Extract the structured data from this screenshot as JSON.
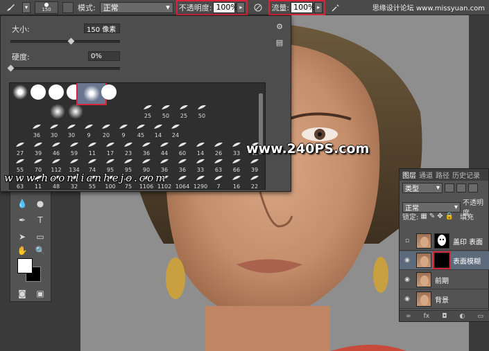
{
  "options_bar": {
    "brush_size": "150",
    "mode_label": "模式:",
    "mode_value": "正常",
    "opacity_label": "不透明度:",
    "opacity_value": "100%",
    "flow_label": "流量:",
    "flow_value": "100%",
    "watermark": "思缘设计论坛 www.missyuan.com"
  },
  "brush_picker": {
    "size_label": "大小:",
    "size_value": "150 像素",
    "size_level": 0.55,
    "hardness_label": "硬度:",
    "hardness_value": "0%",
    "hardness_level": 0.0,
    "row2": [
      "25",
      "50",
      "25",
      "50"
    ],
    "row3": [
      "36",
      "30",
      "30",
      "9",
      "20",
      "9",
      "45",
      "14",
      "24"
    ],
    "row4": [
      "27",
      "39",
      "46",
      "59",
      "11",
      "17",
      "23",
      "36",
      "44",
      "60",
      "14",
      "26",
      "33",
      "42"
    ],
    "row5": [
      "55",
      "70",
      "112",
      "134",
      "74",
      "95",
      "95",
      "90",
      "36",
      "36",
      "33",
      "63",
      "66",
      "39"
    ],
    "row6": [
      "63",
      "11",
      "48",
      "32",
      "55",
      "100",
      "75",
      "1106",
      "1102",
      "1064",
      "1290",
      "7",
      "16",
      "22"
    ]
  },
  "layers_panel": {
    "tabs": [
      "图层",
      "通道",
      "路径",
      "历史记录"
    ],
    "filter_kind": "类型",
    "blend_mode": "正常",
    "opacity_label": "不透明度",
    "lock_label": "锁定:",
    "fill_label": "填充",
    "layers": [
      {
        "name": "盖印 表面",
        "visible": false,
        "selected": false
      },
      {
        "name": "表面模糊",
        "visible": true,
        "selected": true
      },
      {
        "name": "前期",
        "visible": true,
        "selected": false
      },
      {
        "name": "背景",
        "visible": true,
        "selected": false
      }
    ]
  },
  "watermarks": {
    "center": "www.240PS.com",
    "bottom": "www.hoonlianhejo.com"
  }
}
